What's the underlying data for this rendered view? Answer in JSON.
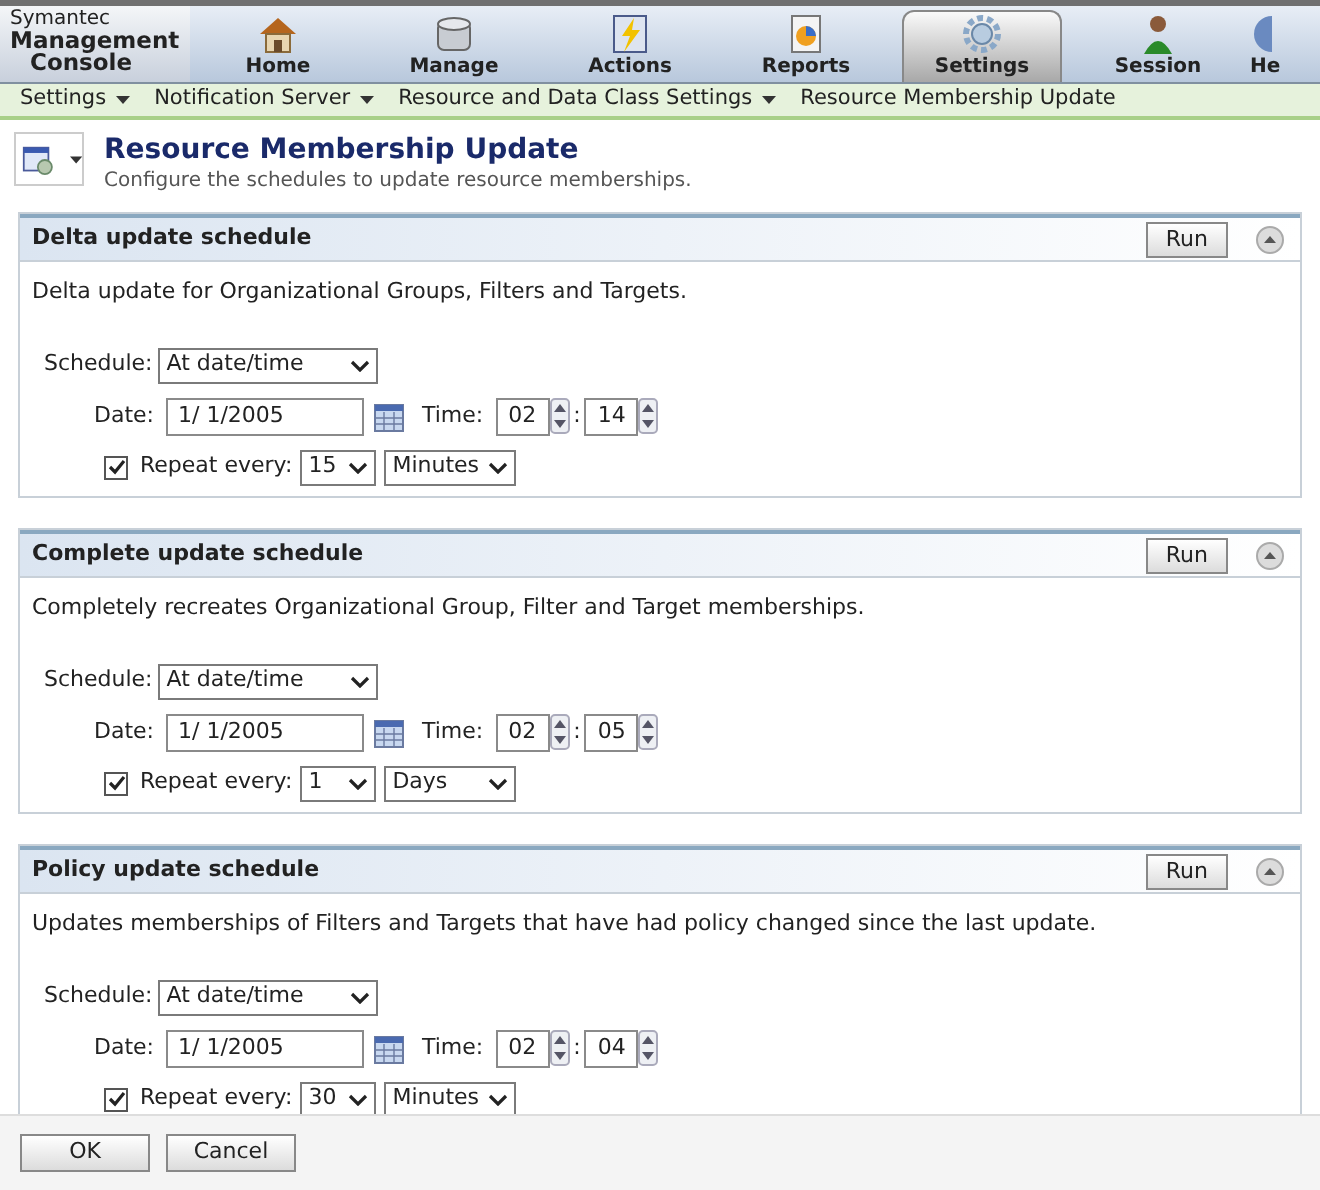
{
  "logo": {
    "line_1": "Symantec",
    "line_2": "Management",
    "line_3": "Console"
  },
  "nav_tabs": [
    {
      "label": "Home",
      "selected": false
    },
    {
      "label": "Manage",
      "selected": false
    },
    {
      "label": "Actions",
      "selected": false
    },
    {
      "label": "Reports",
      "selected": false
    },
    {
      "label": "Settings",
      "selected": true
    },
    {
      "label": "Session",
      "selected": false
    },
    {
      "label": "He",
      "selected": false
    }
  ],
  "breadcrumb": [
    {
      "label": "Settings",
      "dropdown": true
    },
    {
      "label": "Notification Server",
      "dropdown": true
    },
    {
      "label": "Resource and Data Class Settings",
      "dropdown": true
    },
    {
      "label": "Resource Membership Update",
      "dropdown": false
    }
  ],
  "page": {
    "title": "Resource Membership Update",
    "subtitle": "Configure the schedules to update resource memberships."
  },
  "panels": [
    {
      "title": "Delta update schedule",
      "run": "Run",
      "description": "Delta update for Organizational Groups, Filters and Targets.",
      "schedule_label": "Schedule:",
      "schedule": "At date/time",
      "date_label": "Date:",
      "date": "1/ 1/2005",
      "time_label": "Time:",
      "hour": "02",
      "separator": ":",
      "minute": "14",
      "repeat_checked": true,
      "repeat_label": "Repeat every:",
      "repeat_count": "15",
      "repeat_unit": "Minutes"
    },
    {
      "title": "Complete update schedule",
      "run": "Run",
      "description": "Completely recreates Organizational Group, Filter and Target memberships.",
      "schedule_label": "Schedule:",
      "schedule": "At date/time",
      "date_label": "Date:",
      "date": "1/ 1/2005",
      "time_label": "Time:",
      "hour": "02",
      "separator": ":",
      "minute": "05",
      "repeat_checked": true,
      "repeat_label": "Repeat every:",
      "repeat_count": "1",
      "repeat_unit": "Days"
    },
    {
      "title": "Policy update schedule",
      "run": "Run",
      "description": "Updates memberships of Filters and Targets that have had policy changed since the last update.",
      "schedule_label": "Schedule:",
      "schedule": "At date/time",
      "date_label": "Date:",
      "date": "1/ 1/2005",
      "time_label": "Time:",
      "hour": "02",
      "separator": ":",
      "minute": "04",
      "repeat_checked": true,
      "repeat_label": "Repeat every:",
      "repeat_count": "30",
      "repeat_unit": "Minutes"
    }
  ],
  "footer_buttons": [
    "OK",
    "Cancel"
  ]
}
